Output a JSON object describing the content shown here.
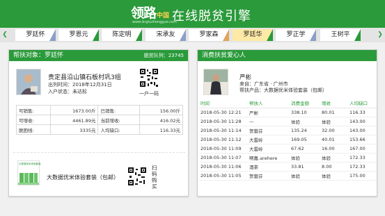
{
  "header": {
    "logo_main": "领路",
    "logo_sub": "中国",
    "logo_url": "www.lingluzhongguo.com",
    "title": "在线脱贫引擎"
  },
  "tabs": [
    {
      "label": "罗廷怀",
      "active": false,
      "corner": "#8ba0c8"
    },
    {
      "label": "罗恩元",
      "active": false,
      "corner": "#2a9a3a"
    },
    {
      "label": "陈定明",
      "active": false,
      "corner": "#2a9a3a"
    },
    {
      "label": "宋承友",
      "active": false,
      "corner": "#8ba0c8"
    },
    {
      "label": "罗家森",
      "active": false,
      "corner": "#e0a45a"
    },
    {
      "label": "罗廷华",
      "active": true,
      "corner": "#2a9a3a"
    },
    {
      "label": "罗正学",
      "active": false,
      "corner": "#8ba0c8"
    },
    {
      "label": "王树平",
      "active": false,
      "corner": "#2a9a3a"
    }
  ],
  "left_panel": {
    "head_title": "帮扶对象：罗廷怀",
    "head_right": "脱贫队列：23745",
    "address": "贵定县沿山镇石板村巩3组",
    "out_time": "出列时间：2018年12月31日",
    "status": "入户状态：未达标",
    "qr_label": "一户一码",
    "stats": [
      [
        "可销售:",
        "1673.00斤",
        "已销售:",
        "156.00斤"
      ],
      [
        "可增收:",
        "4461.89元",
        "当前增收:",
        "416.02元"
      ],
      [
        "脱困线:",
        "3335元",
        "人均缺口:",
        "116.33元"
      ]
    ],
    "product_name": "大数据优米体验套装（包邮）",
    "product_image_text": "大数据优米体验套装",
    "scan_label": "扫码购买"
  },
  "right_panel": {
    "head_title": "消费扶贫爱心人",
    "name": "严彬",
    "from": "来自：广东省 · 广州市",
    "product": "帮扶产品：大数据优米体验套装（包邮）",
    "columns": [
      "时间",
      "帮扶人",
      "消费金额",
      "增收",
      "人均缺口"
    ],
    "rows": [
      [
        "2018-05-30 12:21",
        "严彬",
        "338.10",
        "80.01",
        "116.33"
      ],
      [
        "2018-05-30 11:28",
        "—",
        "体验",
        "体验",
        "143.00"
      ],
      [
        "2018-05-30 11:14",
        "贺蓉芬",
        "135.24",
        "32.00",
        "143.00"
      ],
      [
        "2018-05-30 11:12",
        "大雷岭",
        "169.05",
        "40.01",
        "153.66"
      ],
      [
        "2018-05-30 11:09",
        "大雷岭",
        "67.62",
        "16.00",
        "167.00"
      ],
      [
        "2018-05-30 11:07",
        "啊嘉.arehere",
        "体验",
        "体验",
        "172.33"
      ],
      [
        "2018-05-30 11:06",
        "酒茶",
        "33.81",
        "8.00",
        "172.33"
      ],
      [
        "2018-05-30 11:05",
        "贺蓉芬",
        "体验",
        "体验",
        "175.00"
      ]
    ]
  }
}
